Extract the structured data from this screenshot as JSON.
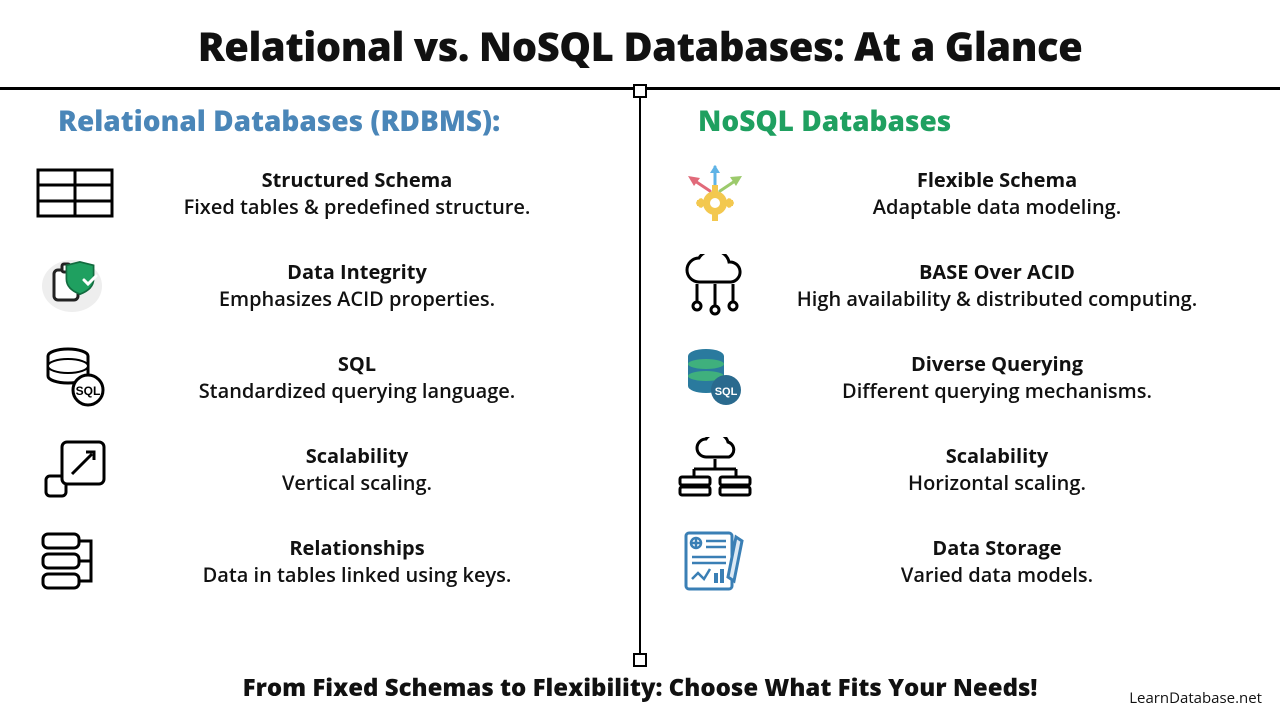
{
  "title": "Relational vs. NoSQL Databases: At a Glance",
  "left": {
    "heading": "Relational Databases (RDBMS):",
    "items": [
      {
        "title": "Structured Schema",
        "sub": "Fixed tables & predefined structure."
      },
      {
        "title": "Data Integrity",
        "sub": "Emphasizes ACID properties."
      },
      {
        "title": "SQL",
        "sub": "Standardized querying language."
      },
      {
        "title": "Scalability",
        "sub": "Vertical scaling."
      },
      {
        "title": "Relationships",
        "sub": "Data in tables linked using keys."
      }
    ]
  },
  "right": {
    "heading": "NoSQL Databases",
    "items": [
      {
        "title": "Flexible Schema",
        "sub": "Adaptable data modeling."
      },
      {
        "title": "BASE Over ACID",
        "sub": "High availability & distributed computing."
      },
      {
        "title": "Diverse Querying",
        "sub": "Different querying mechanisms."
      },
      {
        "title": "Scalability",
        "sub": "Horizontal scaling."
      },
      {
        "title": "Data Storage",
        "sub": "Varied data models."
      }
    ]
  },
  "footer": "From Fixed Schemas to Flexibility: Choose What Fits Your Needs!",
  "source": "LearnDatabase.net"
}
